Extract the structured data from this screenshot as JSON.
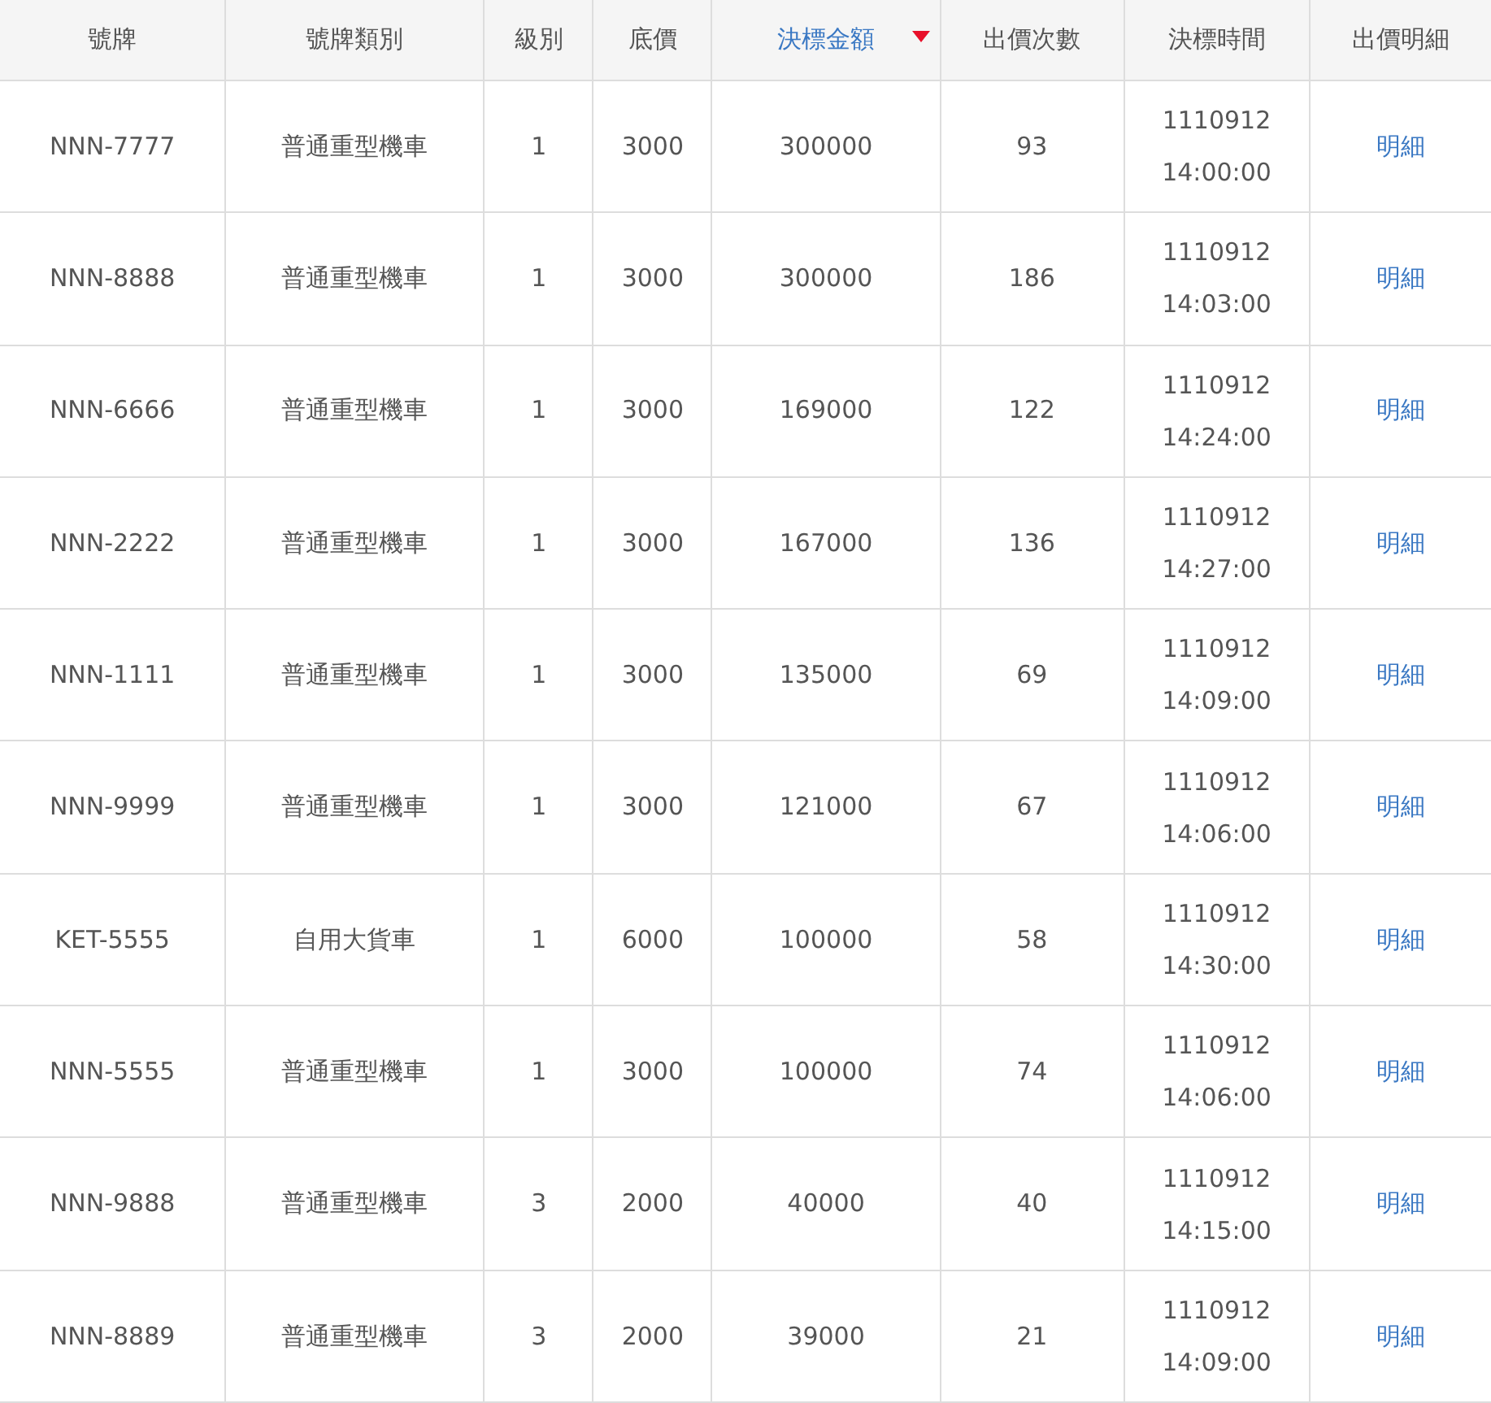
{
  "table": {
    "columns": [
      {
        "label": "號牌",
        "sorted": false
      },
      {
        "label": "號牌類別",
        "sorted": false
      },
      {
        "label": "級別",
        "sorted": false
      },
      {
        "label": "底價",
        "sorted": false
      },
      {
        "label": "決標金額",
        "sorted": true
      },
      {
        "label": "出價次數",
        "sorted": false
      },
      {
        "label": "決標時間",
        "sorted": false
      },
      {
        "label": "出價明細",
        "sorted": false
      }
    ],
    "rows": [
      {
        "plate": "NNN-7777",
        "category": "普通重型機車",
        "level": "1",
        "base": "3000",
        "amount": "300000",
        "bids": "93",
        "date": "1110912",
        "time": "14:00:00",
        "detail": "明細"
      },
      {
        "plate": "NNN-8888",
        "category": "普通重型機車",
        "level": "1",
        "base": "3000",
        "amount": "300000",
        "bids": "186",
        "date": "1110912",
        "time": "14:03:00",
        "detail": "明細"
      },
      {
        "plate": "NNN-6666",
        "category": "普通重型機車",
        "level": "1",
        "base": "3000",
        "amount": "169000",
        "bids": "122",
        "date": "1110912",
        "time": "14:24:00",
        "detail": "明細"
      },
      {
        "plate": "NNN-2222",
        "category": "普通重型機車",
        "level": "1",
        "base": "3000",
        "amount": "167000",
        "bids": "136",
        "date": "1110912",
        "time": "14:27:00",
        "detail": "明細"
      },
      {
        "plate": "NNN-1111",
        "category": "普通重型機車",
        "level": "1",
        "base": "3000",
        "amount": "135000",
        "bids": "69",
        "date": "1110912",
        "time": "14:09:00",
        "detail": "明細"
      },
      {
        "plate": "NNN-9999",
        "category": "普通重型機車",
        "level": "1",
        "base": "3000",
        "amount": "121000",
        "bids": "67",
        "date": "1110912",
        "time": "14:06:00",
        "detail": "明細"
      },
      {
        "plate": "KET-5555",
        "category": "自用大貨車",
        "level": "1",
        "base": "6000",
        "amount": "100000",
        "bids": "58",
        "date": "1110912",
        "time": "14:30:00",
        "detail": "明細"
      },
      {
        "plate": "NNN-5555",
        "category": "普通重型機車",
        "level": "1",
        "base": "3000",
        "amount": "100000",
        "bids": "74",
        "date": "1110912",
        "time": "14:06:00",
        "detail": "明細"
      },
      {
        "plate": "NNN-9888",
        "category": "普通重型機車",
        "level": "3",
        "base": "2000",
        "amount": "40000",
        "bids": "40",
        "date": "1110912",
        "time": "14:15:00",
        "detail": "明細"
      },
      {
        "plate": "NNN-8889",
        "category": "普通重型機車",
        "level": "3",
        "base": "2000",
        "amount": "39000",
        "bids": "21",
        "date": "1110912",
        "time": "14:09:00",
        "detail": "明細"
      }
    ]
  }
}
